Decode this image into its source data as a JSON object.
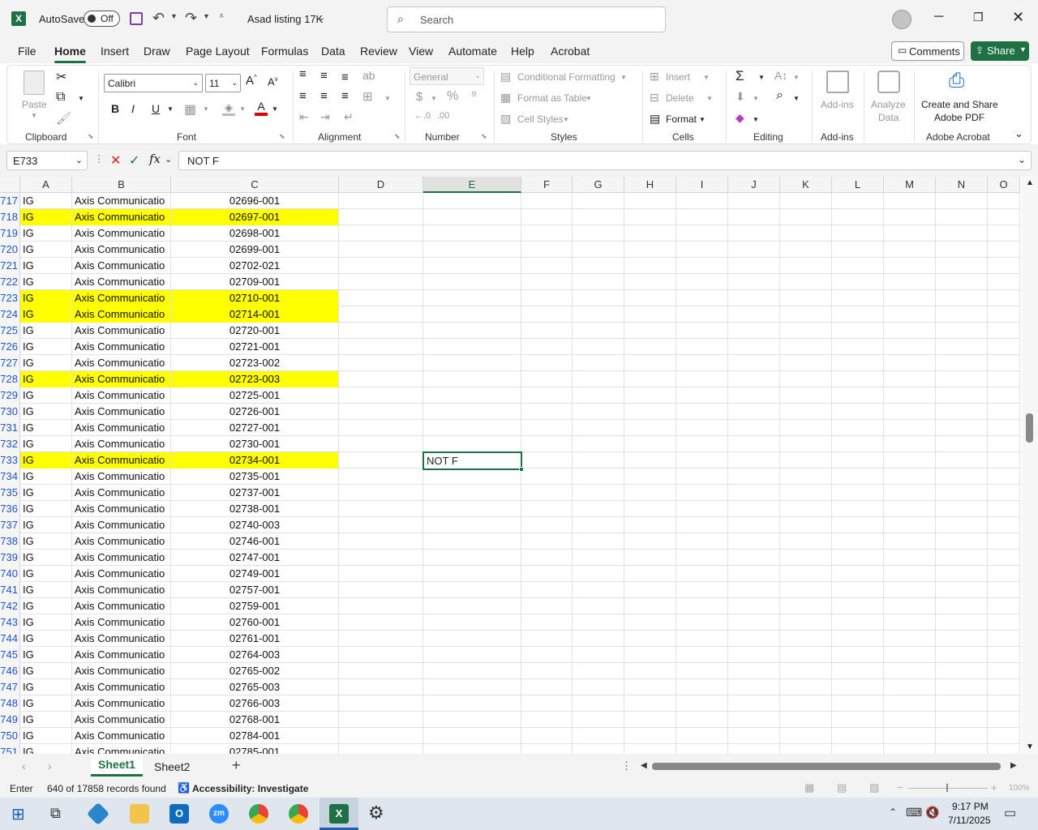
{
  "titlebar": {
    "autosave_label": "AutoSave",
    "toggle_label": "Off",
    "doc_title": "Asad listing 17K",
    "search_placeholder": "Search"
  },
  "menu_tabs": [
    "File",
    "Home",
    "Insert",
    "Draw",
    "Page Layout",
    "Formulas",
    "Data",
    "Review",
    "View",
    "Automate",
    "Help",
    "Acrobat"
  ],
  "comments_label": "Comments",
  "share_label": "Share",
  "ribbon": {
    "paste": "Paste",
    "clipboard": "Clipboard",
    "font_name": "Calibri",
    "font_size": "11",
    "font_group": "Font",
    "alignment": "Alignment",
    "number_format": "General",
    "number": "Number",
    "cond_format": "Conditional Formatting",
    "format_table": "Format as Table",
    "cell_styles": "Cell Styles",
    "styles": "Styles",
    "insert": "Insert",
    "delete": "Delete",
    "format": "Format",
    "cells": "Cells",
    "editing": "Editing",
    "addins": "Add-ins",
    "addins_group": "Add-ins",
    "analyze": "Analyze",
    "analyze2": "Data",
    "create_share": "Create and Share",
    "adobe_pdf": "Adobe PDF",
    "adobe_acrobat": "Adobe Acrobat"
  },
  "namebox": "E733",
  "fx": "fx",
  "formula_value": "NOT F",
  "columns": [
    "A",
    "B",
    "C",
    "D",
    "E",
    "F",
    "G",
    "H",
    "I",
    "J",
    "K",
    "L",
    "M",
    "N",
    "O"
  ],
  "selected_cell_value": "NOT F",
  "rows": [
    {
      "n": "717",
      "a": "IG",
      "b": "Axis Communicatio",
      "c": "02696-001",
      "hl": false
    },
    {
      "n": "718",
      "a": "IG",
      "b": "Axis Communicatio",
      "c": "02697-001",
      "hl": true
    },
    {
      "n": "719",
      "a": "IG",
      "b": "Axis Communicatio",
      "c": "02698-001",
      "hl": false
    },
    {
      "n": "720",
      "a": "IG",
      "b": "Axis Communicatio",
      "c": "02699-001",
      "hl": false
    },
    {
      "n": "721",
      "a": "IG",
      "b": "Axis Communicatio",
      "c": "02702-021",
      "hl": false
    },
    {
      "n": "722",
      "a": "IG",
      "b": "Axis Communicatio",
      "c": "02709-001",
      "hl": false
    },
    {
      "n": "723",
      "a": "IG",
      "b": "Axis Communicatio",
      "c": "02710-001",
      "hl": true
    },
    {
      "n": "724",
      "a": "IG",
      "b": "Axis Communicatio",
      "c": "02714-001",
      "hl": true
    },
    {
      "n": "725",
      "a": "IG",
      "b": "Axis Communicatio",
      "c": "02720-001",
      "hl": false
    },
    {
      "n": "726",
      "a": "IG",
      "b": "Axis Communicatio",
      "c": "02721-001",
      "hl": false
    },
    {
      "n": "727",
      "a": "IG",
      "b": "Axis Communicatio",
      "c": "02723-002",
      "hl": false
    },
    {
      "n": "728",
      "a": "IG",
      "b": "Axis Communicatio",
      "c": "02723-003",
      "hl": true
    },
    {
      "n": "729",
      "a": "IG",
      "b": "Axis Communicatio",
      "c": "02725-001",
      "hl": false
    },
    {
      "n": "730",
      "a": "IG",
      "b": "Axis Communicatio",
      "c": "02726-001",
      "hl": false
    },
    {
      "n": "731",
      "a": "IG",
      "b": "Axis Communicatio",
      "c": "02727-001",
      "hl": false
    },
    {
      "n": "732",
      "a": "IG",
      "b": "Axis Communicatio",
      "c": "02730-001",
      "hl": false
    },
    {
      "n": "733",
      "a": "IG",
      "b": "Axis Communicatio",
      "c": "02734-001",
      "hl": true
    },
    {
      "n": "734",
      "a": "IG",
      "b": "Axis Communicatio",
      "c": "02735-001",
      "hl": false
    },
    {
      "n": "735",
      "a": "IG",
      "b": "Axis Communicatio",
      "c": "02737-001",
      "hl": false
    },
    {
      "n": "736",
      "a": "IG",
      "b": "Axis Communicatio",
      "c": "02738-001",
      "hl": false
    },
    {
      "n": "737",
      "a": "IG",
      "b": "Axis Communicatio",
      "c": "02740-003",
      "hl": false
    },
    {
      "n": "738",
      "a": "IG",
      "b": "Axis Communicatio",
      "c": "02746-001",
      "hl": false
    },
    {
      "n": "739",
      "a": "IG",
      "b": "Axis Communicatio",
      "c": "02747-001",
      "hl": false
    },
    {
      "n": "740",
      "a": "IG",
      "b": "Axis Communicatio",
      "c": "02749-001",
      "hl": false
    },
    {
      "n": "741",
      "a": "IG",
      "b": "Axis Communicatio",
      "c": "02757-001",
      "hl": false
    },
    {
      "n": "742",
      "a": "IG",
      "b": "Axis Communicatio",
      "c": "02759-001",
      "hl": false
    },
    {
      "n": "743",
      "a": "IG",
      "b": "Axis Communicatio",
      "c": "02760-001",
      "hl": false
    },
    {
      "n": "744",
      "a": "IG",
      "b": "Axis Communicatio",
      "c": "02761-001",
      "hl": false
    },
    {
      "n": "745",
      "a": "IG",
      "b": "Axis Communicatio",
      "c": "02764-003",
      "hl": false
    },
    {
      "n": "746",
      "a": "IG",
      "b": "Axis Communicatio",
      "c": "02765-002",
      "hl": false
    },
    {
      "n": "747",
      "a": "IG",
      "b": "Axis Communicatio",
      "c": "02765-003",
      "hl": false
    },
    {
      "n": "748",
      "a": "IG",
      "b": "Axis Communicatio",
      "c": "02766-003",
      "hl": false
    },
    {
      "n": "749",
      "a": "IG",
      "b": "Axis Communicatio",
      "c": "02768-001",
      "hl": false
    },
    {
      "n": "750",
      "a": "IG",
      "b": "Axis Communicatio",
      "c": "02784-001",
      "hl": false
    },
    {
      "n": "751",
      "a": "IG",
      "b": "Axis Communicatio",
      "c": "02785-001",
      "hl": false
    }
  ],
  "sheets": [
    "Sheet1",
    "Sheet2"
  ],
  "status": {
    "mode": "Enter",
    "records": "640 of 17858 records found",
    "accessibility": "Accessibility: Investigate",
    "zoom": "100%"
  },
  "taskbar": {
    "time": "9:17 PM",
    "date": "7/11/2025"
  },
  "colors": {
    "excel_green": "#1e7145",
    "highlight": "#ffff00",
    "rownum_blue": "#1d55c7"
  }
}
